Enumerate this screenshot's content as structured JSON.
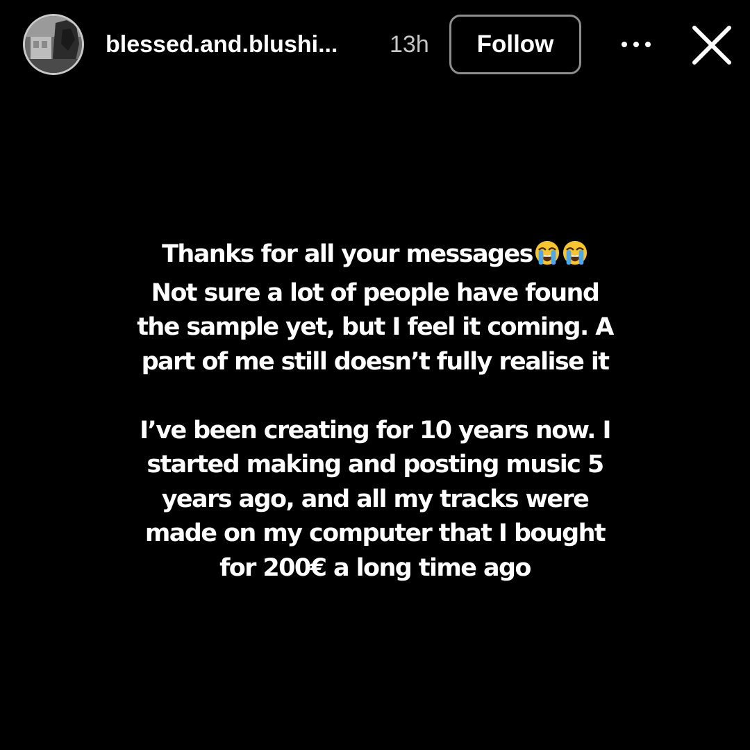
{
  "header": {
    "username": "blessed.and.blushi...",
    "time_ago": "13h",
    "follow_label": "Follow",
    "more_icon": "more-horizontal-icon",
    "close_icon": "close-icon",
    "avatar_icon": "profile-avatar"
  },
  "message": {
    "paragraphs": [
      {
        "lines": [
          "Thanks for all your messages",
          "Not sure a lot of people have found",
          "the sample yet, but I feel it coming. A",
          "part of me still doesn’t fully realise it"
        ],
        "emoji": "loudly-crying-face-icon"
      },
      {
        "lines": [
          "I’ve been creating for 10 years now. I",
          "started making and posting music 5",
          "years ago, and all my tracks were",
          "made on my computer that I bought",
          "for 200€ a long time ago"
        ]
      }
    ]
  },
  "colors": {
    "background": "#000000",
    "text": "#ffffff",
    "secondary_text": "#c7c7c7",
    "button_border": "#8e8e8e",
    "emoji_yellow": "#f7c532",
    "emoji_tears": "#4fa7e6"
  }
}
